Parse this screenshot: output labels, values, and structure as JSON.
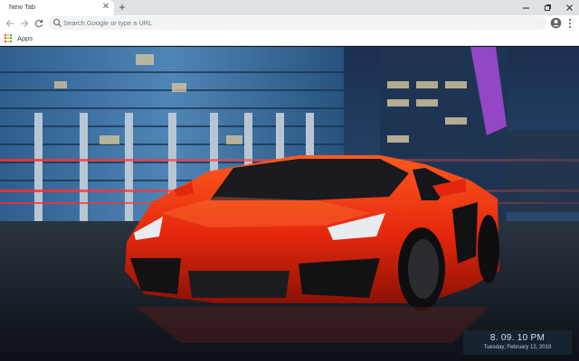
{
  "browser": {
    "tab": {
      "title": "New Tab"
    },
    "new_tab_icon": "plus-icon",
    "window_controls": [
      "minimize-icon",
      "restore-icon",
      "close-icon"
    ],
    "omnibox": {
      "placeholder": "Search Google or type a URL",
      "value": ""
    },
    "bookmarks": {
      "apps_label": "Apps"
    }
  },
  "newtab": {
    "wallpaper_subject": "red sports car in front of glass office towers at night",
    "clock": {
      "time": "8. 09. 10 PM",
      "date": "Tuesday, February 12, 2019"
    }
  },
  "colors": {
    "tabstrip": "#dee1e6",
    "omnibox": "#f1f3f4",
    "car_red": "#e8260e",
    "sky": "#1c2f4a"
  }
}
